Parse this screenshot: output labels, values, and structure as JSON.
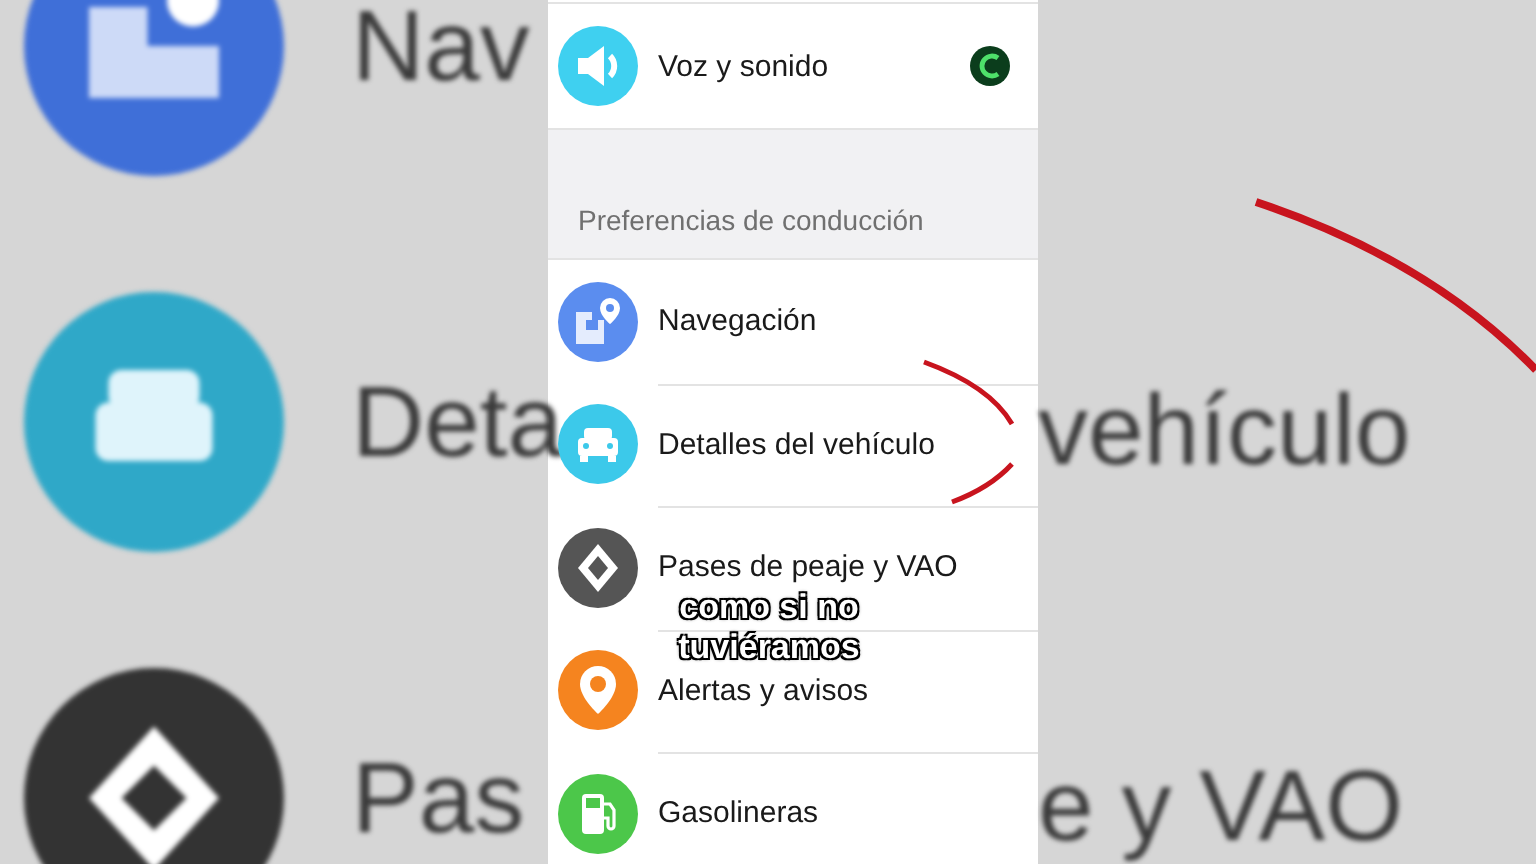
{
  "background": {
    "left_texts": [
      "Nav",
      "Deta",
      "Pas"
    ],
    "right_texts": [
      "vehículo",
      "e y VAO"
    ]
  },
  "settings": {
    "top_row": {
      "label": "Voz y sonido",
      "color": "#3fd0f0"
    },
    "section_header": "Preferencias de conducción",
    "rows": [
      {
        "label": "Navegación",
        "color": "#5b8def"
      },
      {
        "label": "Detalles del vehículo",
        "color": "#3cc9ea"
      },
      {
        "label": "Pases de peaje y VAO",
        "color": "#555555"
      },
      {
        "label": "Alertas y avisos",
        "color": "#f5841f"
      },
      {
        "label": "Gasolineras",
        "color": "#4cc74a"
      }
    ]
  },
  "caption": [
    "como si no",
    "tuviéramos"
  ]
}
